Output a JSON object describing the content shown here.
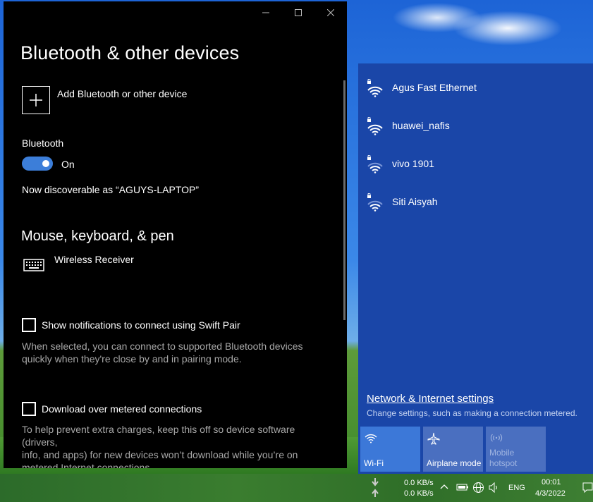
{
  "settings_window": {
    "title": "Bluetooth & other devices",
    "add_device_label": "Add Bluetooth or other device",
    "bluetooth_label": "Bluetooth",
    "toggle_state": "On",
    "discoverable_text": "Now discoverable as “AGUYS-LAPTOP”",
    "section_mouse": "Mouse, keyboard, & pen",
    "device_name": "Wireless Receiver",
    "swift_pair_label": "Show notifications to connect using Swift Pair",
    "swift_pair_desc_1": "When selected, you can connect to supported Bluetooth devices",
    "swift_pair_desc_2": "quickly when they're close by and in pairing mode.",
    "metered_label": "Download over metered connections",
    "metered_desc_1": "To help prevent extra charges, keep this off so device software (drivers,",
    "metered_desc_2": "info, and apps) for new devices won’t download while you’re on",
    "metered_desc_3": "metered Internet connections."
  },
  "network_flyout": {
    "networks": [
      {
        "name": "Agus Fast Ethernet",
        "icon": "wifi-secured-icon"
      },
      {
        "name": "huawei_nafis",
        "icon": "wifi-secured-icon"
      },
      {
        "name": "vivo 1901",
        "icon": "wifi-secured-icon"
      },
      {
        "name": "Siti Aisyah",
        "icon": "wifi-secured-icon"
      }
    ],
    "settings_link": "Network & Internet settings",
    "settings_sub": "Change settings, such as making a connection metered.",
    "quick_actions": [
      {
        "label": "Wi-Fi",
        "active": true
      },
      {
        "label": "Airplane mode",
        "active": false
      },
      {
        "label_1": "Mobile",
        "label_2": "hotspot",
        "disabled": true
      }
    ]
  },
  "taskbar": {
    "download_speed": "0.0 KB/s",
    "upload_speed": "0.0 KB/s",
    "language": "ENG",
    "time": "00:01",
    "date": "4/3/2022"
  },
  "colors": {
    "flyout_bg": "#1a46a8",
    "tile_active": "#3c78d8",
    "tile_inactive": "#4a6fc0",
    "toggle_on": "#3c7ed9"
  }
}
